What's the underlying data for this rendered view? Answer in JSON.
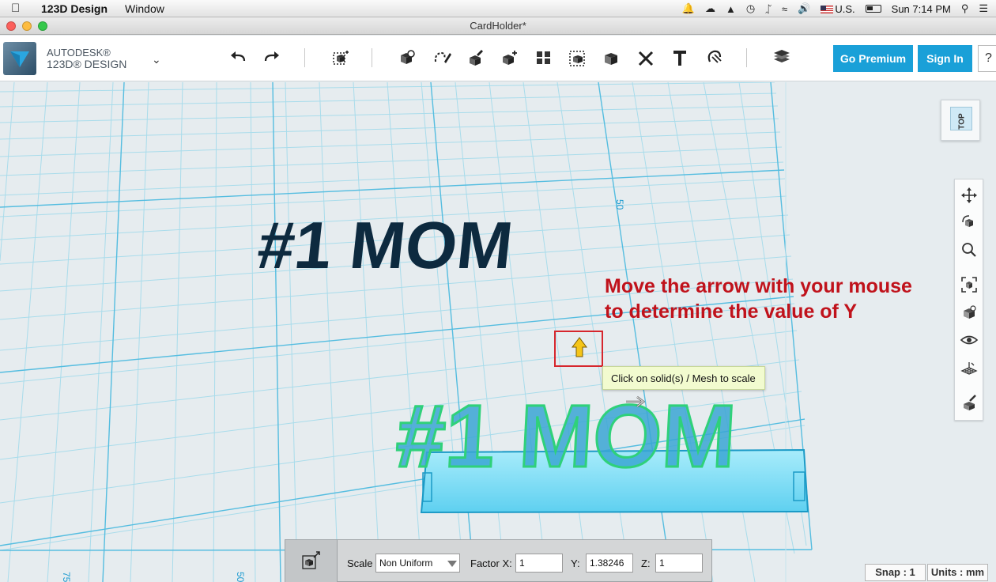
{
  "menubar": {
    "app_name": "123D Design",
    "menu_window": "Window",
    "keyboard_label": "U.S.",
    "clock": "Sun 7:14 PM"
  },
  "window": {
    "title": "CardHolder*"
  },
  "toolbar": {
    "brand_line1": "AUTODESK®",
    "brand_line2": "123D® DESIGN",
    "go_premium": "Go Premium",
    "sign_in": "Sign In",
    "help": "?"
  },
  "viewport": {
    "grid_label_50_right": "50",
    "grid_label_75_bottom": "75",
    "grid_label_50_bottom": "50",
    "text_model_back": "#1 MOM",
    "text_model_front": "#1 MOM",
    "view_cube_face": "TOP",
    "annotation_line1": "Move the arrow with your mouse",
    "annotation_line2": "to determine the value of Y",
    "tooltip": "Click on solid(s) / Mesh to scale"
  },
  "scale_panel": {
    "scale_label": "Scale",
    "scale_mode": "Non Uniform",
    "factor_x_label": "Factor X:",
    "factor_x_value": "1",
    "y_label": "Y:",
    "y_value": "1.38246",
    "z_label": "Z:",
    "z_value": "1"
  },
  "status": {
    "snap": "Snap : 1",
    "units": "Units : mm"
  },
  "colors": {
    "accent_blue": "#1aa0d8",
    "annotation_red": "#c0121b",
    "grid_blue": "#5cc0e0",
    "text_dark": "#0d2a3f",
    "selected_fill": "#3aa6d3",
    "selected_outline": "#2fd17a"
  }
}
